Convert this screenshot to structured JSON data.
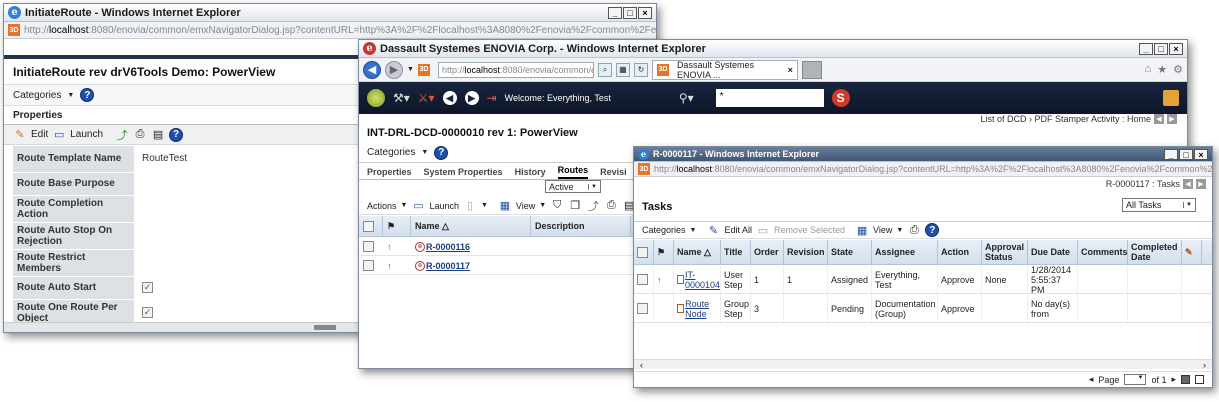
{
  "w1": {
    "title": "InitiateRoute - Windows Internet Explorer",
    "url_prefix": "http://",
    "url_host": "localhost",
    "url_rest": ":8080/enovia/common/emxNavigatorDialog.jsp?contentURL=http%3A%2F%2Flocalhost%3A8080%2Fenovia%2Fcommon%2FemxTree.jsp%...",
    "heading": "InitiateRoute rev drV6Tools Demo: PowerView",
    "categories": "Categories",
    "properties_tab": "Properties",
    "edit": "Edit",
    "launch": "Launch",
    "rows": [
      {
        "label": "Route Template Name",
        "value": "RouteTest"
      },
      {
        "label": "Route Base Purpose",
        "value": ""
      },
      {
        "label": "Route Completion Action",
        "value": ""
      },
      {
        "label": "Route Auto Stop On Rejection",
        "value": ""
      },
      {
        "label": "Route Restrict Members",
        "value": ""
      },
      {
        "label": "Route Auto Start",
        "value": ""
      },
      {
        "label": "Route One Route Per Object",
        "value": ""
      }
    ]
  },
  "w2": {
    "title": "Dassault Systemes ENOVIA Corp. - Windows Internet Explorer",
    "url_prefix": "http://",
    "url_host": "localhost",
    "url_rest": ":8080/enovia/common/e",
    "tab_title": "Dassault Systemes ENOVIA ...",
    "welcome": "Welcome: Everything, Test",
    "search_value": "*",
    "breadcrumb": "List of DCD › PDF Stamper Activity : Home",
    "heading": "INT-DRL-DCD-0000010 rev 1: PowerView",
    "categories": "Categories",
    "tabs": [
      "Properties",
      "System Properties",
      "History",
      "Routes",
      "Revisi"
    ],
    "filter": "Active",
    "actions": "Actions",
    "launch": "Launch",
    "view": "View",
    "col_name": "Name",
    "col_description": "Description",
    "rows": [
      {
        "name": "R-0000116"
      },
      {
        "name": "R-0000117"
      }
    ]
  },
  "w3": {
    "title": "R-0000117 - Windows Internet Explorer",
    "url_prefix": "http://",
    "url_host": "localhost",
    "url_rest": ":8080/enovia/common/emxNavigatorDialog.jsp?contentURL=http%3A%2F%2Flocalhost%3A8080%2Fenovia%2Fcommon%2FemxTree.jsp%...",
    "breadcrumb": "R-0000117 : Tasks",
    "heading": "Tasks",
    "task_filter": "All Tasks",
    "categories": "Categories",
    "edit_all": "Edit All",
    "remove_selected": "Remove Selected",
    "view": "View",
    "columns": [
      "Name",
      "Title",
      "Order",
      "Revision",
      "State",
      "Assignee",
      "Action",
      "Approval Status",
      "Due Date",
      "Comments",
      "Completed Date"
    ],
    "rows": [
      {
        "name": "IT-0000104",
        "title": "User Step",
        "order": "1",
        "revision": "1",
        "state": "Assigned",
        "assignee": "Everything, Test",
        "action": "Approve",
        "approval": "None",
        "due": "1/28/2014 5:55:37 PM",
        "comments": "",
        "completed": ""
      },
      {
        "name": "Route Node",
        "title": "Group Step",
        "order": "3",
        "revision": "",
        "state": "Pending",
        "assignee": "Documentation (Group)",
        "action": "Approve",
        "approval": "",
        "due": "No day(s) from",
        "comments": "",
        "completed": ""
      }
    ],
    "pager_label": "Page",
    "pager_of": "of 1"
  },
  "icons": {
    "check_mark": "✓",
    "help": "?",
    "ie": "e"
  },
  "colors": {
    "enovia_bar": "#18253d",
    "link": "#1a3f80",
    "grid_header": "#d2dfee"
  }
}
